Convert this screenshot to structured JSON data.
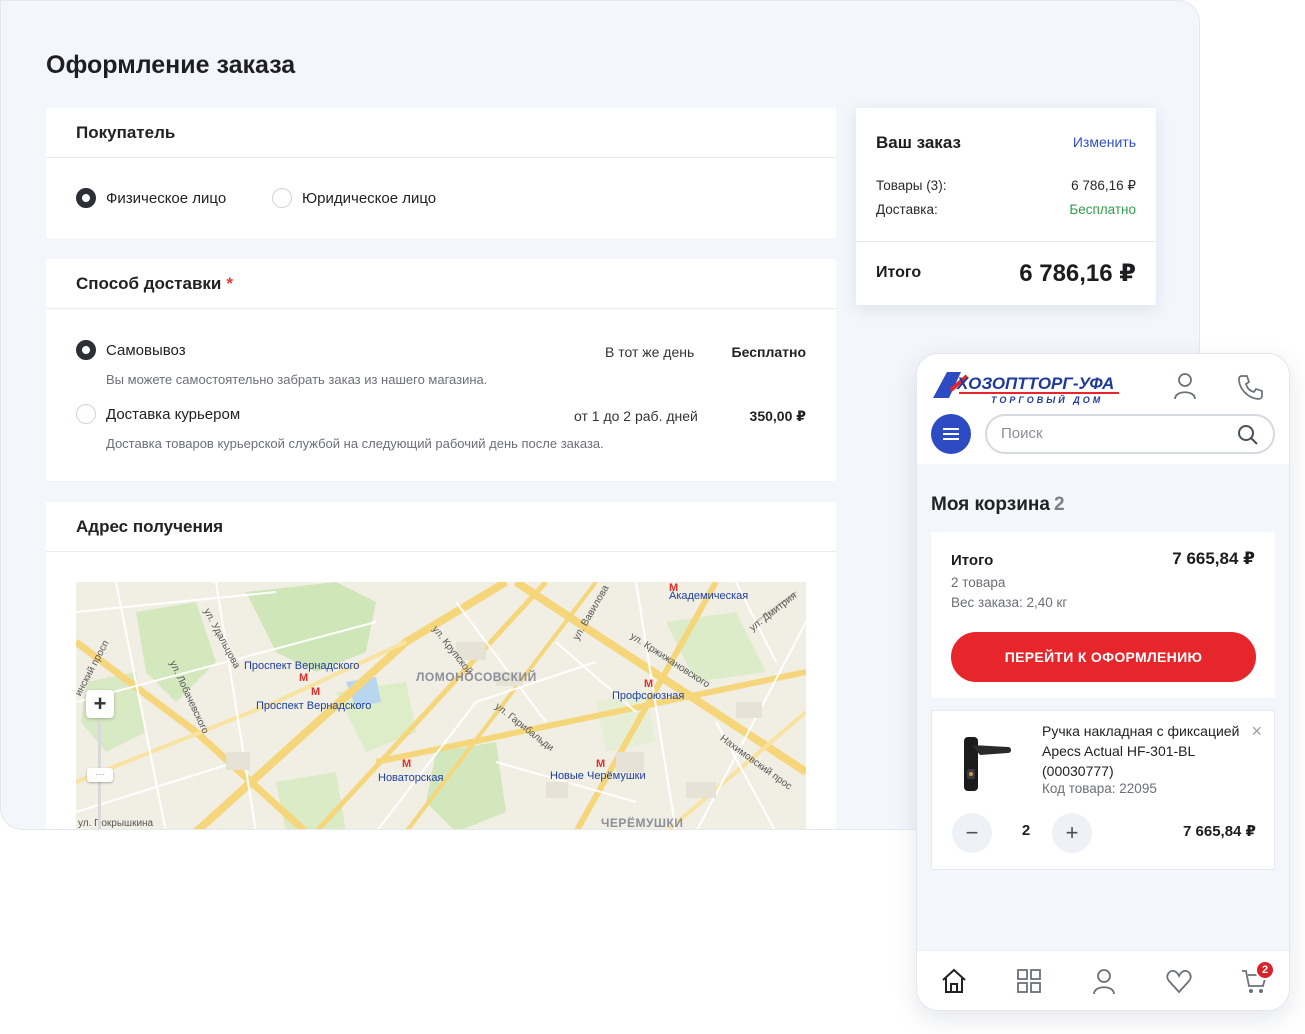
{
  "desktop": {
    "page_title": "Оформление заказа",
    "buyer": {
      "title": "Покупатель",
      "options": [
        "Физическое лицо",
        "Юридическое лицо"
      ],
      "selected_index": 0
    },
    "delivery": {
      "title": "Способ доставки",
      "required_mark": "*",
      "options": [
        {
          "label": "Самовывоз",
          "when": "В тот же день",
          "price": "Бесплатно",
          "note": "Вы можете самостоятельно забрать заказ из нашего магазина.",
          "selected": true
        },
        {
          "label": "Доставка курьером",
          "when": "от 1 до 2 раб. дней",
          "price": "350,00 ₽",
          "note": "Доставка товаров курьерской службой на следующий рабочий день после заказа.",
          "selected": false
        }
      ]
    },
    "address": {
      "title": "Адрес получения",
      "map": {
        "zoom_in": "+",
        "districts": [
          "ЛОМОНОСОВСКИЙ",
          "ЧЕРЁМУШКИ"
        ],
        "metro": [
          "Академическая",
          "Проспект Вернадского",
          "Проспект Вернадского",
          "Профсоюзная",
          "Новаторская",
          "Новые Черёмушки"
        ],
        "streets": [
          "ул. Удальцова",
          "ул. Лобачевского",
          "ул. Крупской",
          "ул. Вавилова",
          "ул. Кржижановского",
          "ул. Дмитрия",
          "ул. Гарибальди",
          "Нахимовский прос",
          "ул. Покрышкина",
          "инский просп"
        ]
      }
    },
    "order": {
      "title": "Ваш заказ",
      "change_label": "Изменить",
      "goods_label": "Товары (3):",
      "goods_value": "6 786,16 ₽",
      "delivery_label": "Доставка:",
      "delivery_value": "Бесплатно",
      "total_label": "Итого",
      "total_value": "6 786,16 ₽"
    }
  },
  "mobile": {
    "logo_text": "ХОЗОПТТОРГ-УФА",
    "logo_sub": "ТОРГОВЫЙ ДОМ",
    "search_placeholder": "Поиск",
    "cart_title": "Моя корзина",
    "cart_count": "2",
    "summary": {
      "total_label": "Итого",
      "total_value": "7 665,84 ₽",
      "items_count": "2 товара",
      "weight": "Вес заказа: 2,40 кг",
      "checkout_button": "ПЕРЕЙТИ К ОФОРМЛЕНИЮ"
    },
    "item": {
      "name": "Ручка накладная с фиксацией Apecs Actual HF-301-BL (00030777)",
      "code": "Код товара: 22095",
      "minus": "−",
      "plus": "+",
      "qty": "2",
      "price": "7 665,84 ₽",
      "close": "×"
    },
    "nav": [
      "home-icon",
      "catalog-icon",
      "profile-icon",
      "favorites-icon",
      "cart-icon"
    ],
    "cart_badge": "2"
  },
  "colors": {
    "accent_blue": "#2d4bc2",
    "accent_red": "#e6262b",
    "free_green": "#2f9d4a",
    "background": "#f3f6fb"
  }
}
